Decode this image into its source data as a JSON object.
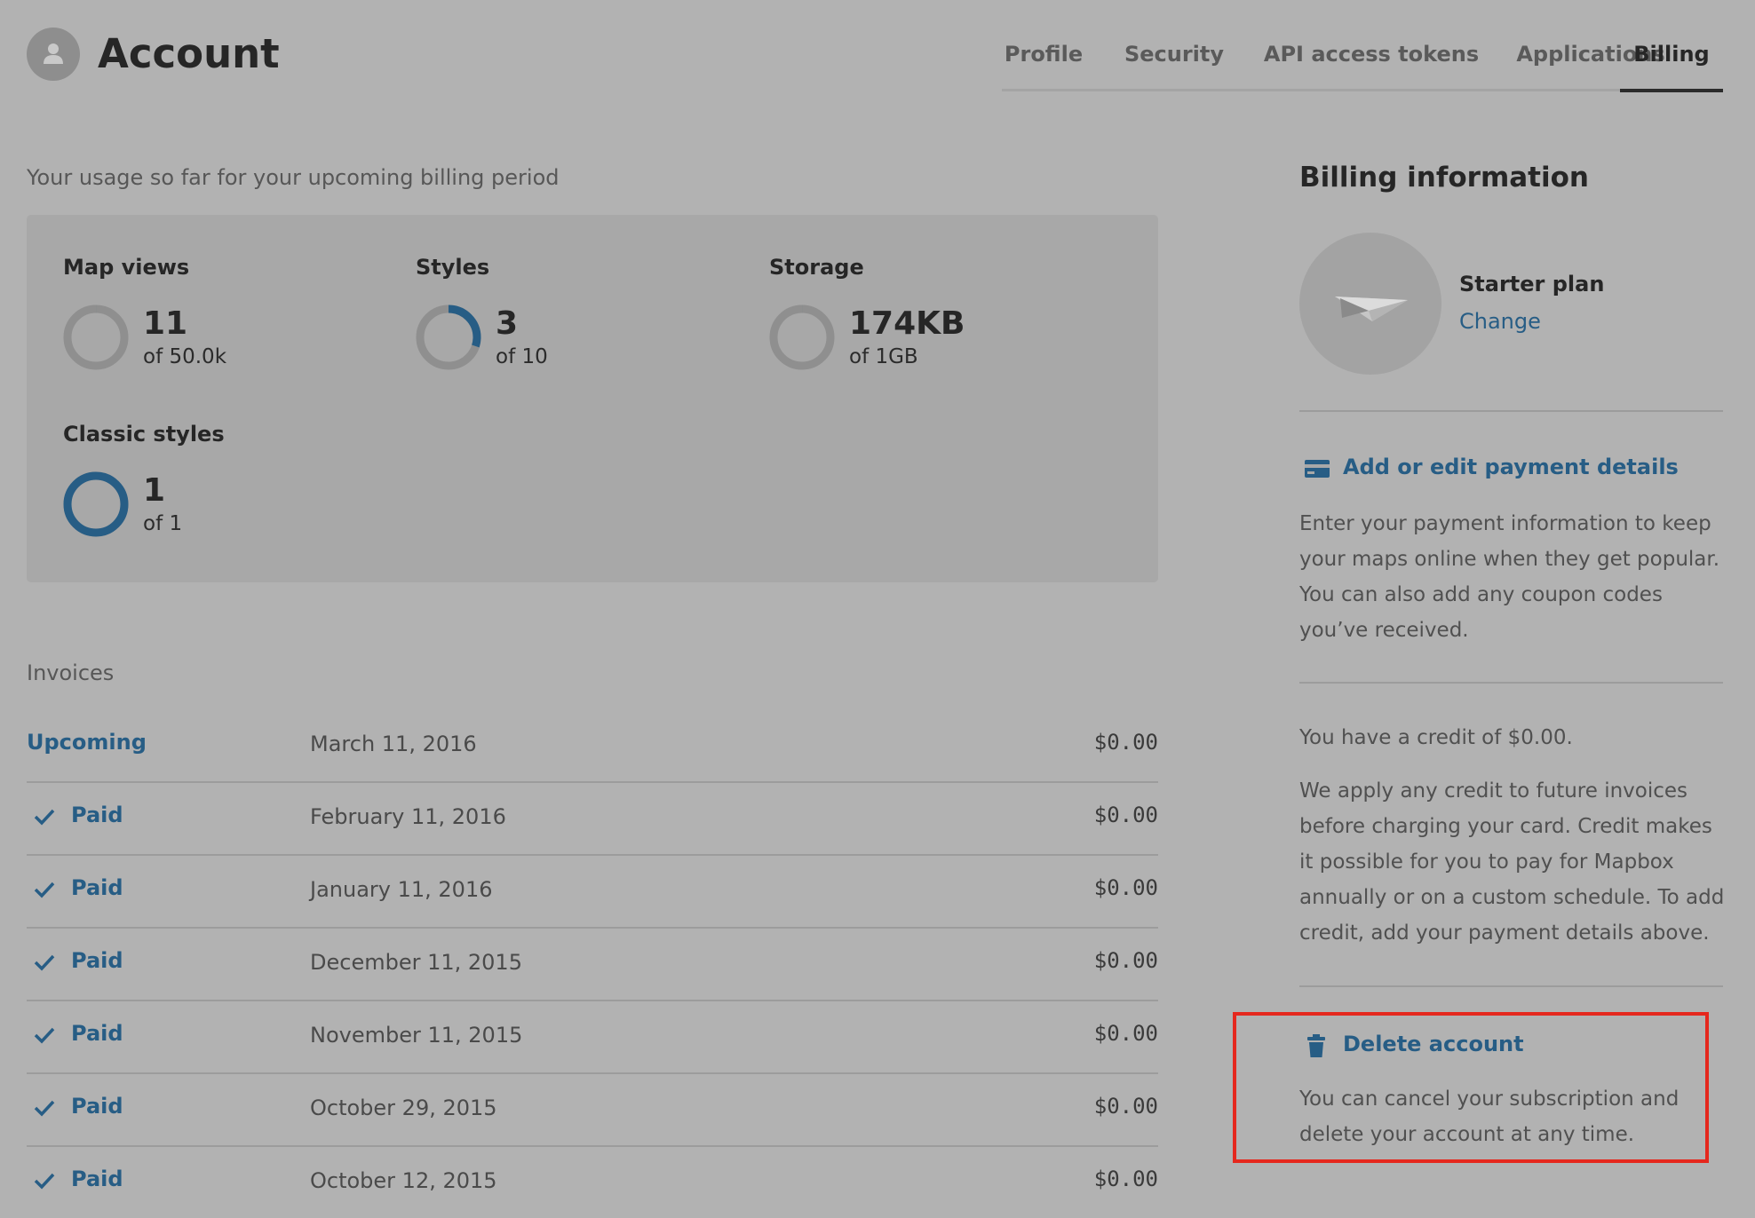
{
  "header": {
    "title": "Account",
    "tabs": [
      {
        "label": "Profile",
        "active": false
      },
      {
        "label": "Security",
        "active": false
      },
      {
        "label": "API access tokens",
        "active": false
      },
      {
        "label": "Applications",
        "active": false
      },
      {
        "label": "Billing",
        "active": true
      }
    ]
  },
  "usage": {
    "caption": "Your usage so far for your upcoming billing period",
    "metrics": [
      {
        "title": "Map views",
        "value": "11",
        "limit": "of 50.0k",
        "fraction": 0.0002
      },
      {
        "title": "Styles",
        "value": "3",
        "limit": "of 10",
        "fraction": 0.3
      },
      {
        "title": "Storage",
        "value": "174KB",
        "limit": "of 1GB",
        "fraction": 0.0002
      },
      {
        "title": "Classic styles",
        "value": "1",
        "limit": "of 1",
        "fraction": 1.0
      }
    ],
    "colors": {
      "ring_track": "#8f8f8f",
      "ring_fill": "#275d85"
    }
  },
  "invoices": {
    "caption": "Invoices",
    "rows": [
      {
        "status": "Upcoming",
        "date": "March 11, 2016",
        "amount": "$0.00"
      },
      {
        "status": "Paid",
        "date": "February 11, 2016",
        "amount": "$0.00"
      },
      {
        "status": "Paid",
        "date": "January 11, 2016",
        "amount": "$0.00"
      },
      {
        "status": "Paid",
        "date": "December 11, 2015",
        "amount": "$0.00"
      },
      {
        "status": "Paid",
        "date": "November 11, 2015",
        "amount": "$0.00"
      },
      {
        "status": "Paid",
        "date": "October 29, 2015",
        "amount": "$0.00"
      },
      {
        "status": "Paid",
        "date": "October 12, 2015",
        "amount": "$0.00"
      }
    ]
  },
  "billing": {
    "title": "Billing information",
    "plan_name": "Starter plan",
    "plan_change": "Change",
    "plan_icon": "paper-plane-icon",
    "payment_link": "Add or edit payment details",
    "payment_icon": "credit-card-icon",
    "payment_text": "Enter your payment information to keep your maps online when they get popular. You can also add any coupon codes you’ve received.",
    "credit_text": "You have a credit of $0.00.",
    "credit_detail": "We apply any credit to future invoices before charging your card. Credit makes it possible for you to pay for Mapbox annually or on a custom schedule. To add credit, add your payment details above.",
    "delete_link": "Delete account",
    "delete_icon": "trash-icon",
    "delete_text": "You can cancel your subscription and delete your account at any time."
  },
  "colors": {
    "accent": "#275d85",
    "highlight": "#e5281e",
    "background": "#b2b2b2"
  }
}
